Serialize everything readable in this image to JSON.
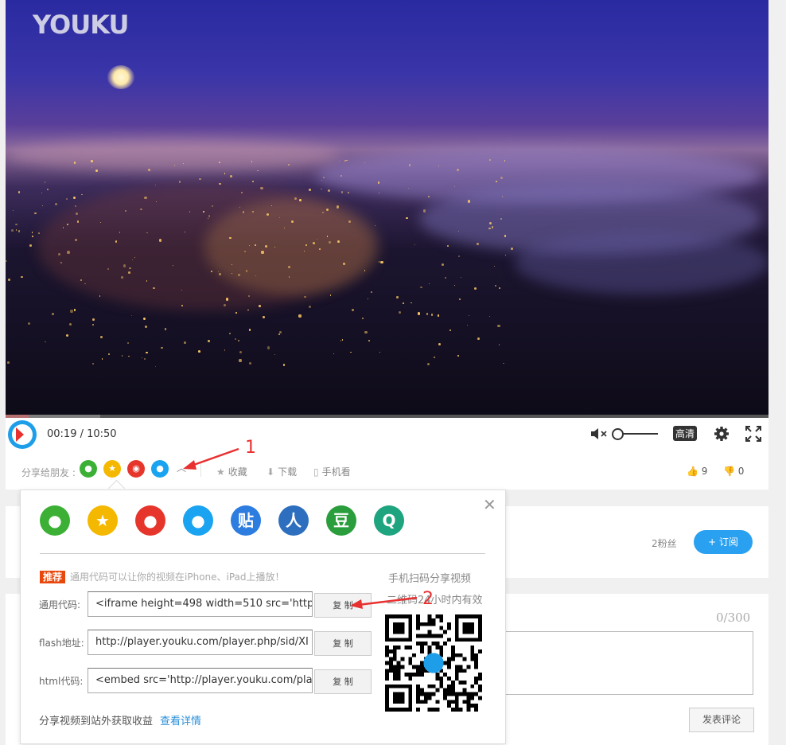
{
  "video": {
    "logo": "YOUKU"
  },
  "player": {
    "time": "00:19 / 10:50",
    "quality_label": "高清",
    "progress": 0.03
  },
  "share_row": {
    "label": "分享给朋友 :",
    "icons": [
      "wechat-icon",
      "qzone-icon",
      "weibo-icon",
      "qq-icon"
    ],
    "favorite": "收藏",
    "download": "下载",
    "mobile": "手机看",
    "likes": "9",
    "dislikes": "0"
  },
  "annotations": {
    "one": "1",
    "two": "2"
  },
  "channel": {
    "fans": "2粉丝",
    "subscribe": "+ 订阅"
  },
  "comment": {
    "counter": "0/300",
    "post_button": "发表评论"
  },
  "popup": {
    "share_targets": [
      {
        "name": "wechat",
        "glyph": "",
        "color": "#3cb035"
      },
      {
        "name": "qzone",
        "glyph": "★",
        "color": "#f5b800"
      },
      {
        "name": "weibo",
        "glyph": "",
        "color": "#e6362c"
      },
      {
        "name": "qq",
        "glyph": "",
        "color": "#1aa3f0"
      },
      {
        "name": "tieba",
        "glyph": "贴",
        "color": "#2d7ce0"
      },
      {
        "name": "renren",
        "glyph": "人",
        "color": "#2d6fbe"
      },
      {
        "name": "douban",
        "glyph": "豆",
        "color": "#2a9d3c"
      },
      {
        "name": "qzone-q",
        "glyph": "Q",
        "color": "#1ea47e"
      }
    ],
    "rec_tag": "推荐",
    "rec_msg": "通用代码可以让你的视频在iPhone、iPad上播放！",
    "rows": [
      {
        "label": "通用代码:",
        "value": "<iframe height=498 width=510 src='http:",
        "button": "复 制"
      },
      {
        "label": "flash地址:",
        "value": "http://player.youku.com/player.php/sid/XI",
        "button": "复 制"
      },
      {
        "label": "html代码:",
        "value": "<embed src='http://player.youku.com/pla",
        "button": "复 制"
      }
    ],
    "qr_title": "手机扫码分享视频",
    "qr_sub": "二维码24小时内有效",
    "footer_text": "分享视频到站外获取收益",
    "footer_link": "查看详情"
  }
}
